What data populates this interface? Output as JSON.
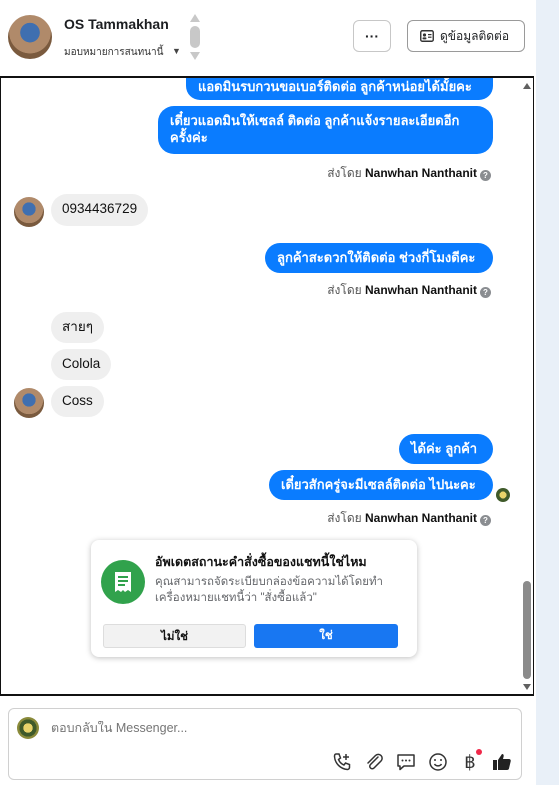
{
  "header": {
    "contact_name": "OS Tammakhan",
    "assign_label": "มอบหมายการสนทนานี้",
    "more_label": "···",
    "contact_info_label": "ดูข้อมูลติดต่อ"
  },
  "messages": [
    {
      "text": "แอดมินรบกวนขอเบอร์ติดต่อ ลูกค้าหน่อยได้มั้ยคะ"
    },
    {
      "text_line1": "เดี๋ยวแอดมินให้เซลล์ ติดต่อ ลูกค้าแจ้งรายละเอียดอีก",
      "text_line2": "ครั้งค่ะ"
    },
    {
      "text": "0934436729"
    },
    {
      "text": "ลูกค้าสะดวกให้ติดต่อ ช่วงกี่โมงดีคะ"
    },
    {
      "text": "สายๆ"
    },
    {
      "text": "Colola"
    },
    {
      "text": "Coss"
    },
    {
      "text": "ได้ค่ะ  ลูกค้า"
    },
    {
      "text": "เดี๋ยวสักครู่จะมีเซลล์ติดต่อ ไปนะคะ"
    }
  ],
  "sent_by": {
    "prefix": "ส่งโดย",
    "name": "Nanwhan Nanthanit",
    "info": "?"
  },
  "prompt_card": {
    "title": "อัพเดตสถานะคำสั่งซื้อของแชทนี้ใช่ไหม",
    "description": "คุณสามารถจัดระเบียบกล่องข้อความได้โดยทำเครื่องหมายแชทนี้ว่า \"สั่งซื้อแล้ว\"",
    "no_label": "ไม่ใช่",
    "yes_label": "ใช่"
  },
  "composer": {
    "placeholder": "ตอบกลับใน Messenger...",
    "currency_symbol": "฿"
  },
  "colors": {
    "outgoing_bubble": "#0a7cff",
    "incoming_bubble": "#efefef",
    "primary_button": "#1877f2",
    "card_icon": "#31a24c"
  },
  "icons": [
    "avatar",
    "stepper-icon",
    "contact-card-icon",
    "info-icon",
    "order-receipt-icon",
    "add-call-icon",
    "attach-icon",
    "saved-reply-icon",
    "emoji-icon",
    "currency-icon",
    "thumbs-up-icon"
  ]
}
